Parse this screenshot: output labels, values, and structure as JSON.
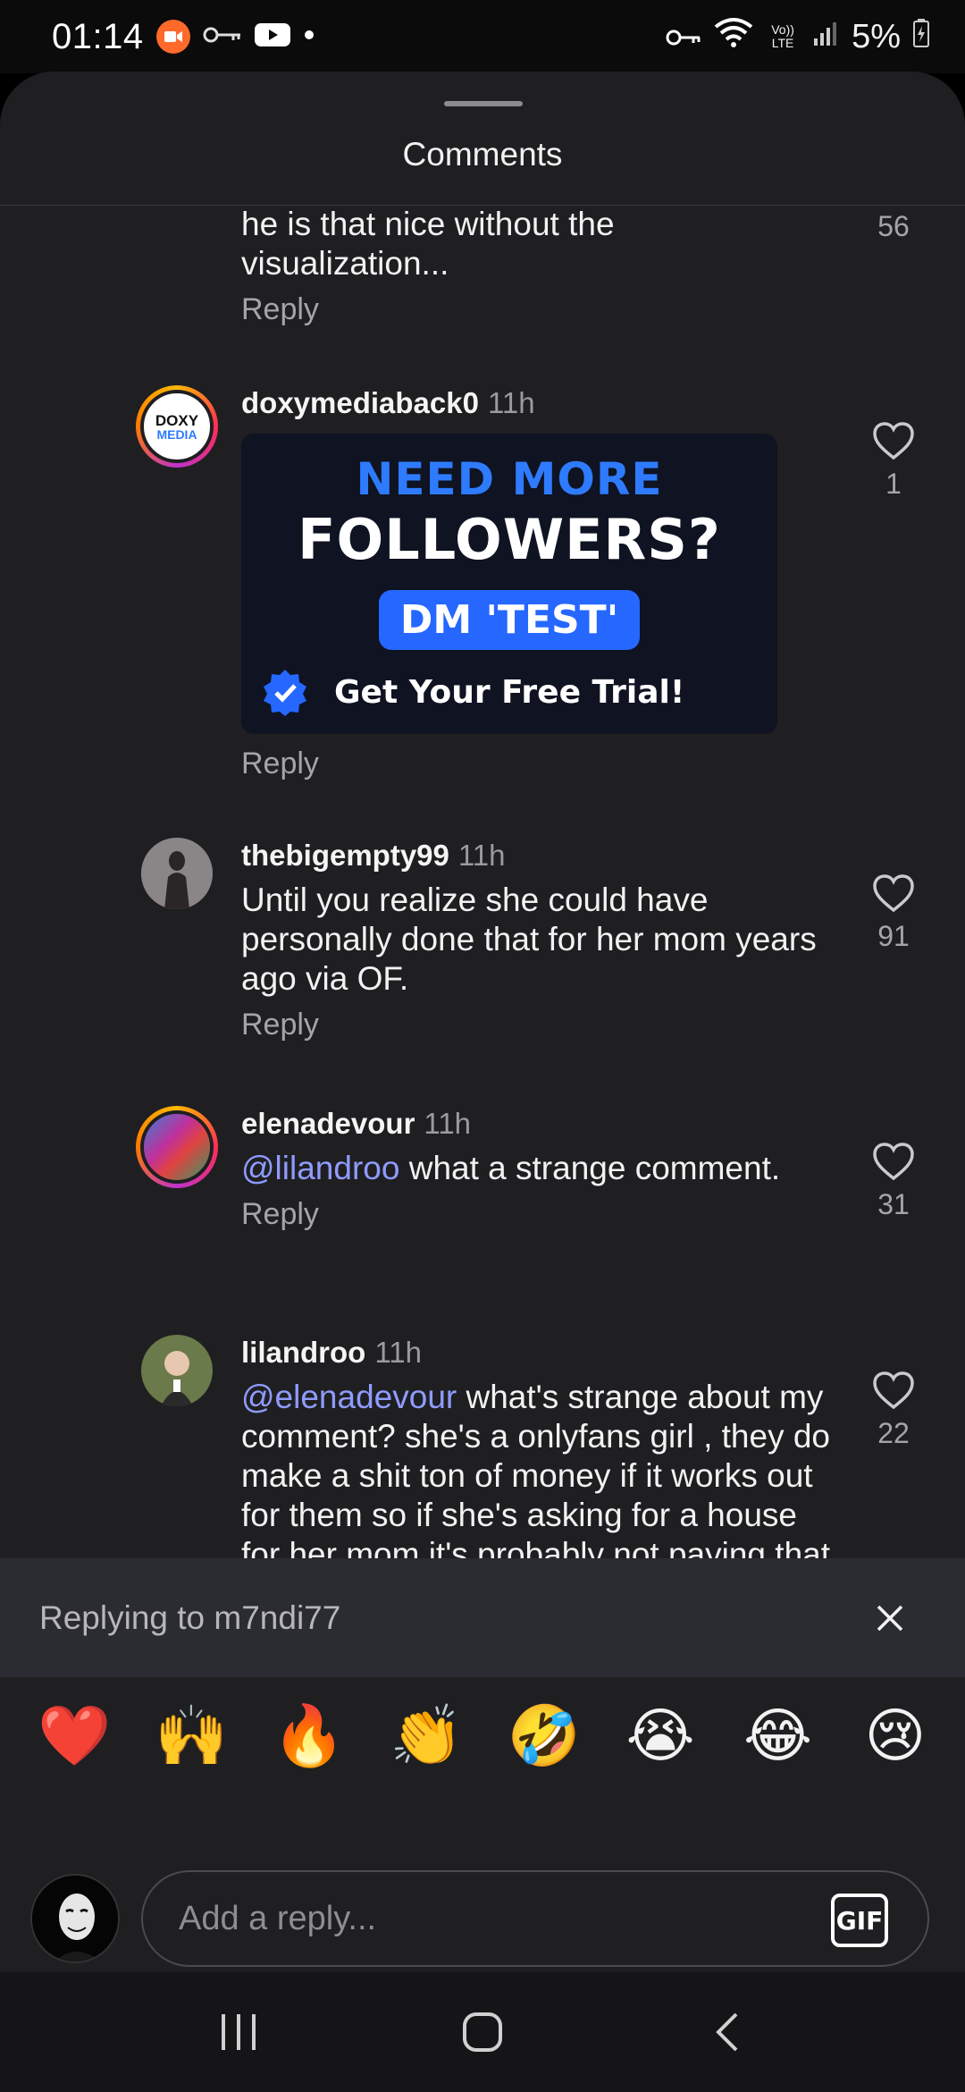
{
  "status_bar": {
    "time": "01:14",
    "volte": "Vo)) LTE",
    "battery": "5%"
  },
  "sheet": {
    "title": "Comments"
  },
  "comments": [
    {
      "text": "he is that nice without the visualization...",
      "reply_label": "Reply",
      "likes": "56"
    },
    {
      "username": "doxymediaback0",
      "time": "11h",
      "avatar_text_1": "DOXY",
      "avatar_text_2": "MEDIA",
      "ad": {
        "line1": "NEED MORE",
        "line2": "FOLLOWERS?",
        "button": "DM 'TEST'",
        "footer": "Get Your Free Trial!"
      },
      "reply_label": "Reply",
      "likes": "1"
    },
    {
      "username": "thebigempty99",
      "time": "11h",
      "text": "Until you realize she could have personally done that for her mom years ago via OF.",
      "reply_label": "Reply",
      "likes": "91"
    },
    {
      "username": "elenadevour",
      "time": "11h",
      "mention": "@lilandroo",
      "text": " what a strange comment.",
      "reply_label": "Reply",
      "likes": "31"
    },
    {
      "username": "lilandroo",
      "time": "11h",
      "mention": "@elenadevour",
      "text": " what's strange about my comment? she's a onlyfans girl , they do make a shit ton of money if it works out for them so if she's asking for a house for her mom it's probably not paying that much",
      "likes": "22"
    }
  ],
  "replying": {
    "text": "Replying to m7ndi77"
  },
  "emoji_bar": [
    "❤️",
    "🙌",
    "🔥",
    "👏",
    "🤣",
    "😭",
    "😂",
    "😢"
  ],
  "composer": {
    "placeholder": "Add a reply...",
    "gif_label": "GIF"
  },
  "colors": {
    "sheet_bg": "#1f1f22",
    "mention": "#8f9bff",
    "ad_blue": "#2567ff"
  }
}
